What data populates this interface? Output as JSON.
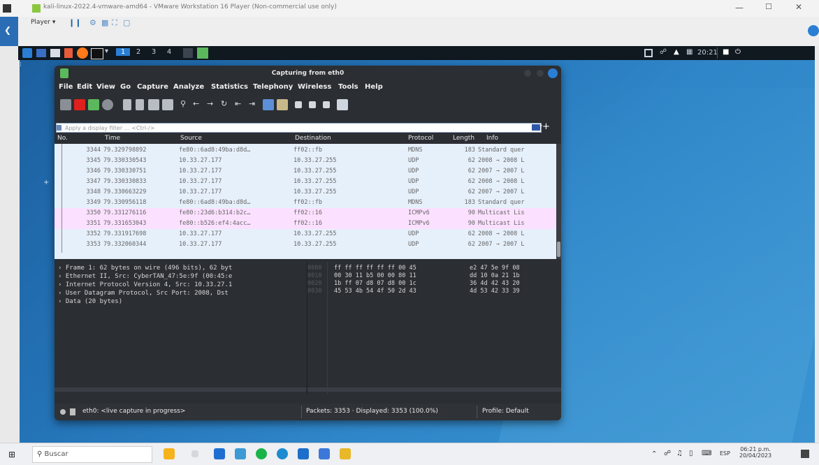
{
  "vm_window": {
    "title": "kali-linux-2022.4-vmware-amd64 - VMware Workstation 16 Player (Non-commercial use only)",
    "player_label": "Player"
  },
  "kali_panel": {
    "workspaces": [
      "1",
      "2",
      "3",
      "4"
    ],
    "clock": "20:21"
  },
  "wireshark": {
    "title": "Capturing from eth0",
    "menu": [
      "File",
      "Edit",
      "View",
      "Go",
      "Capture",
      "Analyze",
      "Statistics",
      "Telephony",
      "Wireless",
      "Tools",
      "Help"
    ],
    "filter_placeholder": "Apply a display filter … <Ctrl-/>",
    "columns": [
      "No.",
      "Time",
      "Source",
      "Destination",
      "Protocol",
      "Length",
      "Info"
    ],
    "packets": [
      {
        "no": "3344",
        "time": "79.329798892",
        "source": "fe80::6ad8:49ba:d8d…",
        "destination": "ff02::fb",
        "protocol": "MDNS",
        "length": "183",
        "info": "Standard quer",
        "style": "normal"
      },
      {
        "no": "3345",
        "time": "79.330330543",
        "source": "10.33.27.177",
        "destination": "10.33.27.255",
        "protocol": "UDP",
        "length": "62",
        "info": "2008 → 2008 L",
        "style": "normal"
      },
      {
        "no": "3346",
        "time": "79.330330751",
        "source": "10.33.27.177",
        "destination": "10.33.27.255",
        "protocol": "UDP",
        "length": "62",
        "info": "2007 → 2007 L",
        "style": "normal"
      },
      {
        "no": "3347",
        "time": "79.330330833",
        "source": "10.33.27.177",
        "destination": "10.33.27.255",
        "protocol": "UDP",
        "length": "62",
        "info": "2008 → 2008 L",
        "style": "normal"
      },
      {
        "no": "3348",
        "time": "79.330663229",
        "source": "10.33.27.177",
        "destination": "10.33.27.255",
        "protocol": "UDP",
        "length": "62",
        "info": "2007 → 2007 L",
        "style": "normal"
      },
      {
        "no": "3349",
        "time": "79.330956118",
        "source": "fe80::6ad8:49ba:d8d…",
        "destination": "ff02::fb",
        "protocol": "MDNS",
        "length": "183",
        "info": "Standard quer",
        "style": "normal"
      },
      {
        "no": "3350",
        "time": "79.331276116",
        "source": "fe80::23d6:b314:b2c…",
        "destination": "ff02::16",
        "protocol": "ICMPv6",
        "length": "90",
        "info": "Multicast Lis",
        "style": "icmp"
      },
      {
        "no": "3351",
        "time": "79.331653043",
        "source": "fe80::b526:ef4:4acc…",
        "destination": "ff02::16",
        "protocol": "ICMPv6",
        "length": "90",
        "info": "Multicast Lis",
        "style": "icmp"
      },
      {
        "no": "3352",
        "time": "79.331917698",
        "source": "10.33.27.177",
        "destination": "10.33.27.255",
        "protocol": "UDP",
        "length": "62",
        "info": "2008 → 2008 L",
        "style": "normal"
      },
      {
        "no": "3353",
        "time": "79.332060344",
        "source": "10.33.27.177",
        "destination": "10.33.27.255",
        "protocol": "UDP",
        "length": "62",
        "info": "2007 → 2007 L",
        "style": "normal"
      }
    ],
    "details": [
      "Frame 1: 62 bytes on wire (496 bits), 62 byt",
      "Ethernet II, Src: CyberTAN_47:5e:9f (00:45:e",
      "Internet Protocol Version 4, Src: 10.33.27.1",
      "User Datagram Protocol, Src Port: 2008, Dst",
      "Data (20 bytes)"
    ],
    "bytes": [
      {
        "offset": "0000",
        "hex1": "ff ff ff ff ff ff 00 45",
        "hex2": "e2 47 5e 9f 08"
      },
      {
        "offset": "0010",
        "hex1": "00 30 11 b5 00 00 80 11",
        "hex2": "dd 10 0a 21 1b"
      },
      {
        "offset": "0020",
        "hex1": "1b ff 07 d8 07 d8 00 1c",
        "hex2": "36 4d 42 43 20"
      },
      {
        "offset": "0030",
        "hex1": "45 53 4b 54 4f 50 2d 43",
        "hex2": "4d 53 42 33 39"
      }
    ],
    "status": {
      "capture": "eth0: <live capture in progress>",
      "packets": "Packets: 3353 · Displayed: 3353 (100.0%)",
      "profile": "Profile: Default"
    }
  },
  "taskbar": {
    "search_placeholder": "Buscar",
    "lang": "ESP",
    "time": "06:21 p.m.",
    "date": "20/04/2023"
  },
  "colors": {
    "row_normal": "#e6f0fb",
    "row_icmp": "#fce0ff",
    "accent": "#2a7fd4"
  }
}
